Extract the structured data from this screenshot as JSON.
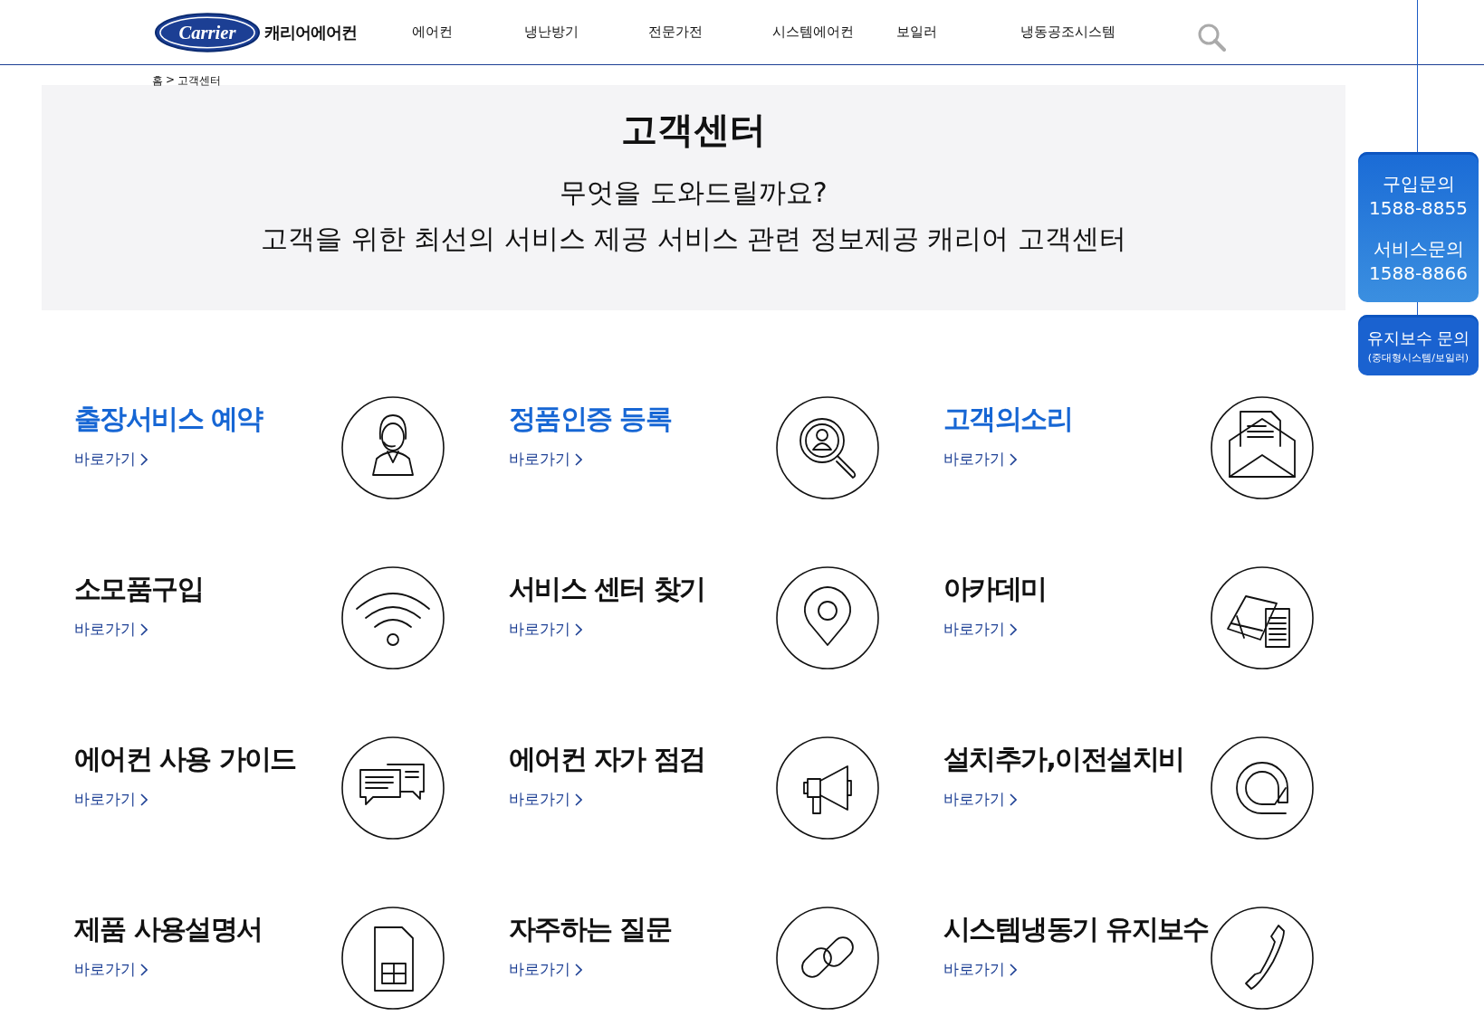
{
  "header": {
    "logo": "Carrier",
    "brand": "캐리어에어컨",
    "nav": [
      "에어컨",
      "냉난방기",
      "전문가전",
      "시스템에어컨",
      "보일러",
      "냉동공조시스템"
    ]
  },
  "breadcrumb": {
    "home": "홈",
    "separator": ">",
    "current": "고객센터"
  },
  "banner": {
    "title": "고객센터",
    "lines": [
      "무엇을 도와드릴까요?",
      "고객을 위한 최선의 서비스 제공 서비스 관련 정보제공 캐리어 고객센터"
    ]
  },
  "side_buttons": [
    {
      "lines": [
        "구입문의",
        "1588-8855",
        "서비스문의",
        "1588-8866"
      ]
    },
    {
      "lines": [
        "유지보수 문의",
        "(중대형시스템/보일러)"
      ]
    }
  ],
  "services": [
    {
      "title": "출장서비스 예약",
      "link": "바로가기",
      "highlighted": true
    },
    {
      "title": "정품인증 등록",
      "link": "바로가기",
      "highlighted": true
    },
    {
      "title": "고객의소리",
      "link": "바로가기",
      "highlighted": true
    },
    {
      "title": "소모품구입",
      "link": "바로가기",
      "highlighted": false
    },
    {
      "title": "서비스 센터 찾기",
      "link": "바로가기",
      "highlighted": false
    },
    {
      "title": "아카데미",
      "link": "바로가기",
      "highlighted": false
    },
    {
      "title": "에어컨 사용 가이드",
      "link": "바로가기",
      "highlighted": false
    },
    {
      "title": "에어컨 자가 점검",
      "link": "바로가기",
      "highlighted": false
    },
    {
      "title": "설치추가,이전설치비",
      "link": "바로가기",
      "highlighted": false
    },
    {
      "title": "제품 사용설명서",
      "link": "바로가기",
      "highlighted": false
    },
    {
      "title": "자주하는 질문",
      "link": "바로가기",
      "highlighted": false
    },
    {
      "title": "시스템냉동기 유지보수",
      "link": "바로가기",
      "highlighted": false
    }
  ]
}
